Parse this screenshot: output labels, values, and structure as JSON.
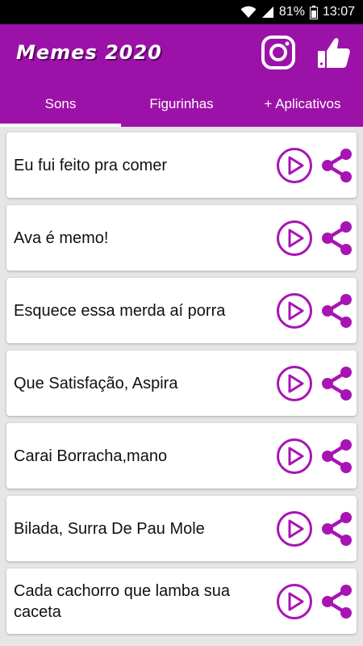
{
  "status_bar": {
    "battery": "81%",
    "time": "13:07"
  },
  "app_bar": {
    "title": "Memes 2020",
    "instagram_icon": "instagram-icon",
    "like_icon": "thumbs-up-icon"
  },
  "tabs": [
    {
      "label": "Sons",
      "active": true
    },
    {
      "label": "Figurinhas",
      "active": false
    },
    {
      "label": "+ Aplicativos",
      "active": false
    }
  ],
  "sounds": [
    {
      "title": "Eu fui feito pra comer"
    },
    {
      "title": "Ava é memo!"
    },
    {
      "title": "Esquece essa merda aí porra"
    },
    {
      "title": "Que Satisfação, Aspira"
    },
    {
      "title": "Carai Borracha,mano"
    },
    {
      "title": "Bilada, Surra De Pau Mole"
    },
    {
      "title": "Cada cachorro que lamba sua caceta"
    }
  ],
  "colors": {
    "primary": "#9c12a8",
    "icon": "#a814b4",
    "background": "#e6e6e6"
  }
}
